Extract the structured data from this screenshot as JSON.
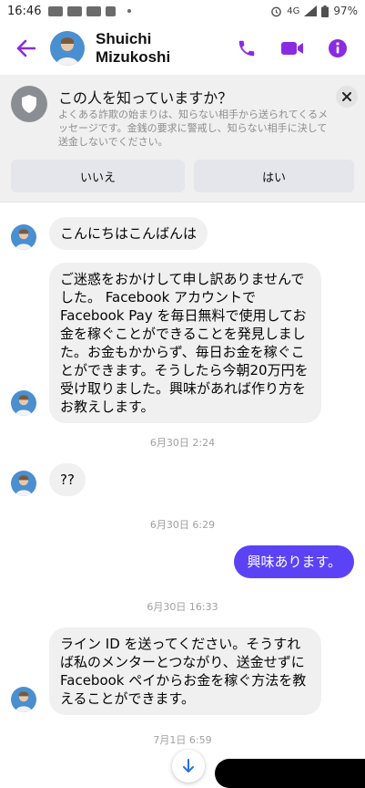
{
  "status_bar": {
    "time": "16:46",
    "network": "4G",
    "battery": "97%"
  },
  "header": {
    "contact_name": "Shuichi  Mizukoshi",
    "accent_color": "#8a2be2"
  },
  "safety_prompt": {
    "title": "この人を知っていますか？",
    "body": "よくある詐欺の始まりは、知らない相手から送られてくるメッセージです。金銭の要求に警戒し、知らない相手に決して送金しないでください。",
    "no_label": "いいえ",
    "yes_label": "はい"
  },
  "messages": [
    {
      "direction": "in",
      "text": "こんにちはこんばんは"
    },
    {
      "direction": "in",
      "text": "ご迷惑をおかけして申し訳ありませんでした。 Facebook アカウントで Facebook Pay を毎日無料で使用してお金を稼ぐことができることを発見しました。お金もかからず、毎日お金を稼ぐことができます。そうしたら今朝20万円を受け取りました。興味があれば作り方をお教えします。"
    },
    {
      "timestamp": "6月30日 2:24"
    },
    {
      "direction": "in",
      "text": "??"
    },
    {
      "timestamp": "6月30日 6:29"
    },
    {
      "direction": "out",
      "text": "興味あります。"
    },
    {
      "timestamp": "6月30日 16:33"
    },
    {
      "direction": "in",
      "text": "ライン ID を送ってください。そうすれば私のメンターとつながり、送金せずに Facebook ペイからお金を稼ぐ方法を教えることができます。"
    },
    {
      "timestamp": "7月1日 6:59"
    }
  ],
  "colors": {
    "outgoing_bubble": "#5b43f5",
    "incoming_bubble": "#f0f0f0"
  }
}
